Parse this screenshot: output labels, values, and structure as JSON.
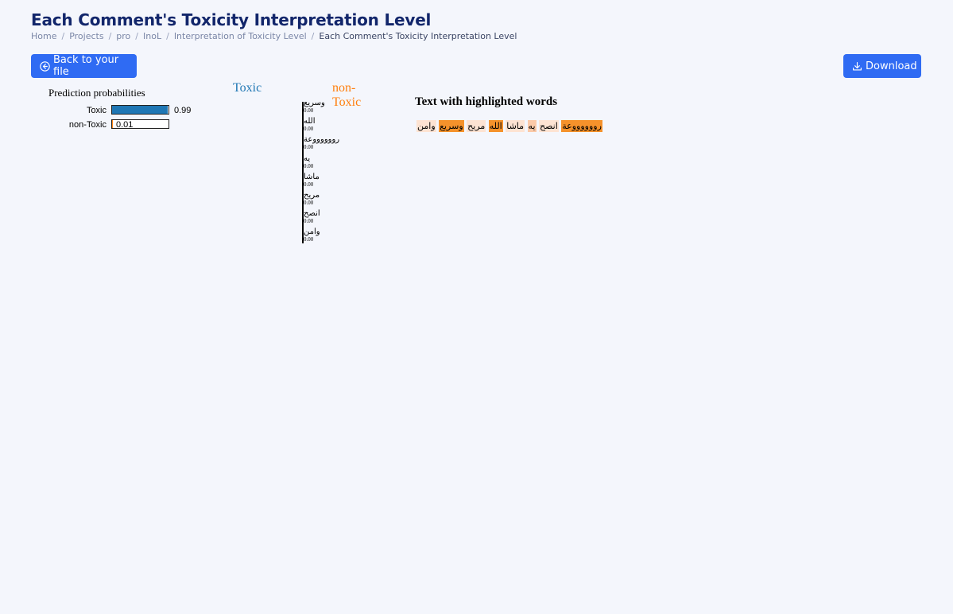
{
  "header": {
    "title": "Each Comment's Toxicity Interpretation Level",
    "breadcrumb": [
      "Home",
      "Projects",
      "pro",
      "InoL",
      "Interpretation of Toxicity Level",
      "Each Comment's Toxicity Interpretation Level"
    ]
  },
  "toolbar": {
    "back_label": "Back to your file",
    "download_label": "Download"
  },
  "prediction": {
    "title": "Prediction probabilities",
    "rows": [
      {
        "label": "Toxic",
        "value": "0.99",
        "fraction": 0.99,
        "color": "#1f77b4"
      },
      {
        "label": "non-Toxic",
        "value": "0.01",
        "fraction": 0.01,
        "color": "#ff7f0e"
      }
    ]
  },
  "classes": {
    "toxic": "Toxic",
    "non_toxic": "non-Toxic"
  },
  "features": [
    {
      "word": "وسريع",
      "value": "0.00"
    },
    {
      "word": "الله",
      "value": "0.00"
    },
    {
      "word": "رووووووعة",
      "value": "0.00"
    },
    {
      "word": "يه",
      "value": "0.00"
    },
    {
      "word": "ماشا",
      "value": "0.00"
    },
    {
      "word": "مريح",
      "value": "0.00"
    },
    {
      "word": "انصح",
      "value": "0.00"
    },
    {
      "word": "وامن",
      "value": "0.00"
    }
  ],
  "highlight": {
    "title": "Text with highlighted words",
    "words": [
      {
        "word": "رووووووعة",
        "color": "#f5922b"
      },
      {
        "word": "انصح",
        "color": "#fde3d2"
      },
      {
        "word": "يه",
        "color": "#fbc9a8"
      },
      {
        "word": "ماشا",
        "color": "#fde3d2"
      },
      {
        "word": "الله",
        "color": "#f5922b"
      },
      {
        "word": "مريح",
        "color": "#fde3d2"
      },
      {
        "word": "وسريع",
        "color": "#f5922b"
      },
      {
        "word": "وامن",
        "color": "#fde3d2"
      }
    ]
  }
}
